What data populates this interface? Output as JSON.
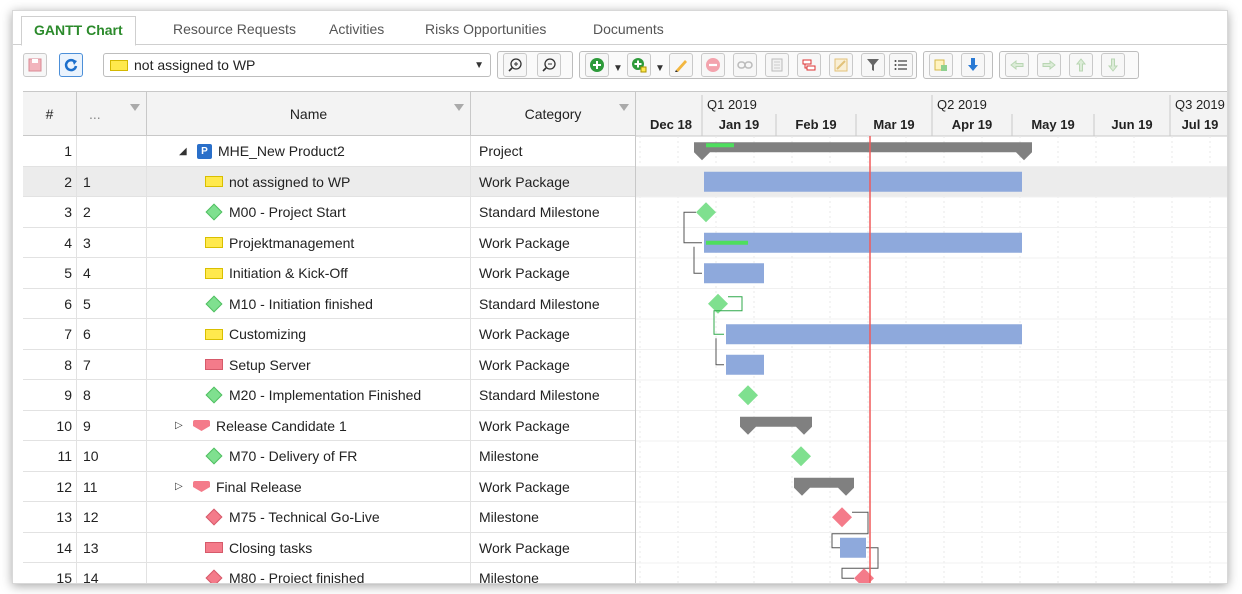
{
  "tabs": [
    {
      "label": "GANTT Chart",
      "active": true
    },
    {
      "label": "Resource Requests",
      "active": false
    },
    {
      "label": "Activities",
      "active": false
    },
    {
      "label": "Risks Opportunities",
      "active": false
    },
    {
      "label": "Documents",
      "active": false
    }
  ],
  "toolbar": {
    "wp_filter_value": "not assigned to WP",
    "buttons": [
      "save-icon",
      "refresh-icon",
      "zoom-in-icon",
      "zoom-out-icon",
      "add-icon",
      "add-child-icon",
      "edit-pencil-icon",
      "delete-icon",
      "link-icon",
      "notes-icon",
      "split-icon",
      "baseline-icon",
      "filter-icon",
      "list-icon",
      "assign-icon",
      "download-icon",
      "arrow-left-icon",
      "arrow-right-icon",
      "arrow-up-icon",
      "arrow-down-icon"
    ]
  },
  "grid": {
    "columns": {
      "num": "#",
      "wbs": "...",
      "name": "Name",
      "category": "Category"
    },
    "rows": [
      {
        "num": "1",
        "wbs": "",
        "name": "MHE_New Product2",
        "category": "Project",
        "icon": "project-icon",
        "indent": 0,
        "toggle": "◢"
      },
      {
        "num": "2",
        "wbs": "1",
        "name": "not assigned to WP",
        "category": "Work Package",
        "icon": "wp-yellow",
        "indent": 1,
        "selected": true
      },
      {
        "num": "3",
        "wbs": "2",
        "name": "M00 - Project Start",
        "category": "Standard Milestone",
        "icon": "ms-green",
        "indent": 1
      },
      {
        "num": "4",
        "wbs": "3",
        "name": "Projektmanagement",
        "category": "Work Package",
        "icon": "wp-yellow",
        "indent": 1
      },
      {
        "num": "5",
        "wbs": "4",
        "name": "Initiation & Kick-Off",
        "category": "Work Package",
        "icon": "wp-yellow",
        "indent": 1
      },
      {
        "num": "6",
        "wbs": "5",
        "name": "M10 - Initiation finished",
        "category": "Standard Milestone",
        "icon": "ms-green",
        "indent": 1
      },
      {
        "num": "7",
        "wbs": "6",
        "name": "Customizing",
        "category": "Work Package",
        "icon": "wp-yellow",
        "indent": 1
      },
      {
        "num": "8",
        "wbs": "7",
        "name": "Setup Server",
        "category": "Work Package",
        "icon": "wp-red",
        "indent": 1
      },
      {
        "num": "9",
        "wbs": "8",
        "name": "M20 - Implementation Finished",
        "category": "Standard Milestone",
        "icon": "ms-green",
        "indent": 1
      },
      {
        "num": "10",
        "wbs": "9",
        "name": "Release Candidate 1",
        "category": "Work Package",
        "icon": "summary-red",
        "indent": 0,
        "toggle": "▷"
      },
      {
        "num": "11",
        "wbs": "10",
        "name": "M70 - Delivery of FR",
        "category": "Milestone",
        "icon": "ms-green",
        "indent": 1
      },
      {
        "num": "12",
        "wbs": "11",
        "name": "Final Release",
        "category": "Work Package",
        "icon": "summary-red",
        "indent": 0,
        "toggle": "▷"
      },
      {
        "num": "13",
        "wbs": "12",
        "name": "M75 - Technical Go-Live",
        "category": "Milestone",
        "icon": "ms-red",
        "indent": 1
      },
      {
        "num": "14",
        "wbs": "13",
        "name": "Closing tasks",
        "category": "Work Package",
        "icon": "wp-red",
        "indent": 1
      },
      {
        "num": "15",
        "wbs": "14",
        "name": "M80 - Project finished",
        "category": "Milestone",
        "icon": "ms-red",
        "indent": 1
      }
    ]
  },
  "timeline": {
    "quarters": [
      "Q1 2019",
      "Q2 2019",
      "Q3 2019"
    ],
    "months": [
      "Dec 18",
      "Jan 19",
      "Feb 19",
      "Mar 19",
      "Apr 19",
      "May 19",
      "Jun 19",
      "Jul 19"
    ],
    "today_line_color": "#f05a5a",
    "bar_color": "#8ea9dc",
    "summary_color": "#808080",
    "milestone_green": "#7fe08f",
    "milestone_red": "#f47b8a",
    "progress_color": "#4ede5e"
  }
}
